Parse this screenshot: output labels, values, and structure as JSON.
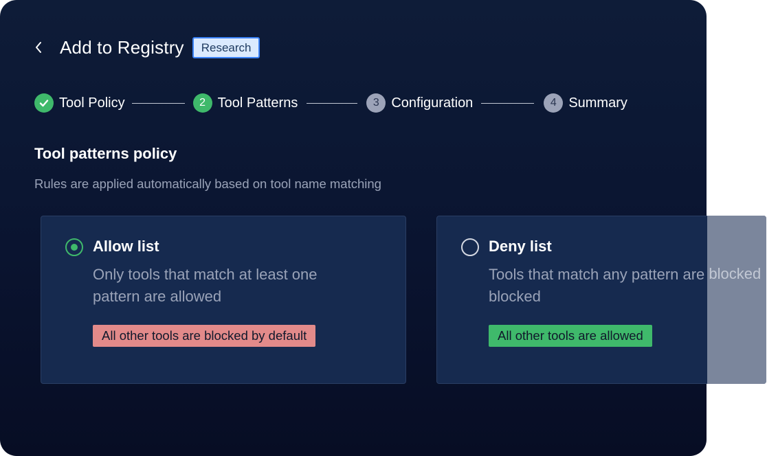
{
  "header": {
    "title": "Add to Registry",
    "badge": "Research"
  },
  "stepper": {
    "steps": [
      {
        "number": "",
        "label": "Tool Policy",
        "state": "done"
      },
      {
        "number": "2",
        "label": "Tool Patterns",
        "state": "active"
      },
      {
        "number": "3",
        "label": "Configuration",
        "state": "pending"
      },
      {
        "number": "4",
        "label": "Summary",
        "state": "pending"
      }
    ]
  },
  "section": {
    "title": "Tool patterns policy",
    "subtitle": "Rules are applied automatically based on tool name matching"
  },
  "options": {
    "allow": {
      "title": "Allow list",
      "description": "Only tools that match at least one pattern are allowed",
      "tag": "All other tools are blocked by default",
      "selected": true
    },
    "deny": {
      "title": "Deny list",
      "description": "Tools that match any pattern are blocked",
      "tag": "All other tools are allowed",
      "selected": false
    }
  },
  "colors": {
    "accent_green": "#3fb96b",
    "tag_red": "#e28a8a",
    "badge_blue": "#3b82f6"
  }
}
